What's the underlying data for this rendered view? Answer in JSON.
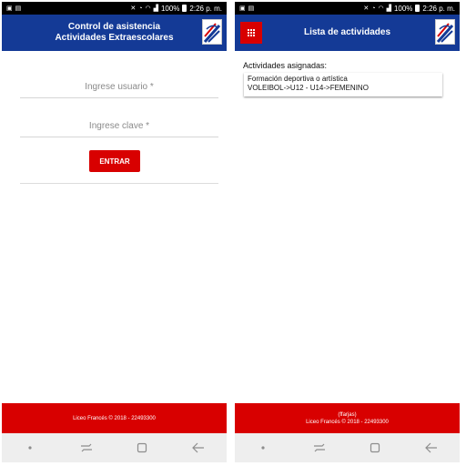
{
  "status_bar": {
    "battery": "100%",
    "time": "2:26 p. m."
  },
  "login_screen": {
    "title_line1": "Control de asistencia",
    "title_line2": "Actividades Extraescolares",
    "user_placeholder": "Ingrese usuario *",
    "password_placeholder": "Ingrese clave *",
    "enter_button": "ENTRAR",
    "footer": "Liceo Francés © 2018 - 22493300"
  },
  "activities_screen": {
    "title": "Lista de actividades",
    "section_label": "Actividades asignadas:",
    "activities": [
      {
        "line1": "Formación deportiva o artística",
        "line2": "VOLEIBOL->U12 - U14->FEMENINO"
      }
    ],
    "footer_user": "(ffarjas)",
    "footer": "Liceo Francés © 2018 - 22493300"
  },
  "icons": {
    "status_left": [
      "image-icon",
      "notification-icon"
    ],
    "status_right": [
      "mute-icon",
      "alarm-icon",
      "wifi-icon",
      "signal-icon",
      "battery-icon"
    ],
    "nav": [
      "home-dot-icon",
      "recent-apps-icon",
      "home-icon",
      "back-icon"
    ]
  },
  "colors": {
    "app_bar": "#143a96",
    "accent": "#d80000",
    "status_bar": "#000000",
    "nav_bar": "#eeeeee"
  }
}
